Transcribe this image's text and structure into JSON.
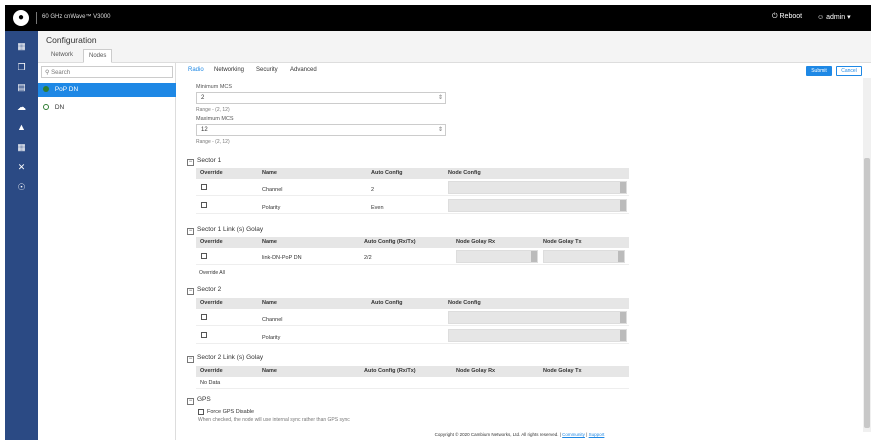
{
  "topbar": {
    "product": "60 GHz cnWave™ V3000",
    "reboot_label": "Reboot",
    "admin_label": "admin",
    "reboot_icon": "power-icon",
    "admin_icon": "user-icon",
    "dropdown_icon": "caret-down-icon"
  },
  "sidebar_icons": [
    "dashboard-icon",
    "copy-icon",
    "document-icon",
    "cloud-icon",
    "bell-icon",
    "calendar-icon",
    "tools-icon",
    "wireless-icon"
  ],
  "header": {
    "title": "Configuration",
    "tabs": [
      {
        "label": "Network",
        "active": false
      },
      {
        "label": "Nodes",
        "active": true
      }
    ]
  },
  "tree": {
    "search_placeholder": "Search",
    "nodes": [
      {
        "label": "PoP DN",
        "selected": true
      },
      {
        "label": "DN",
        "selected": false
      }
    ]
  },
  "tabs": [
    {
      "label": "Radio",
      "active": true
    },
    {
      "label": "Networking",
      "active": false
    },
    {
      "label": "Security",
      "active": false
    },
    {
      "label": "Advanced",
      "active": false
    }
  ],
  "buttons": {
    "submit": "Submit",
    "cancel": "Cancel"
  },
  "mcs": {
    "min_label": "Minimum MCS",
    "min_value": "2",
    "min_range": "Range - (2, 12)",
    "max_label": "Maximum MCS",
    "max_value": "12",
    "max_range": "Range - (2, 12)"
  },
  "sector1": {
    "title": "Sector 1",
    "columns": [
      "Override",
      "Name",
      "Auto Config",
      "Node Config"
    ],
    "rows": [
      {
        "name": "Channel",
        "auto": "2"
      },
      {
        "name": "Polarity",
        "auto": "Even"
      }
    ]
  },
  "sector1_golay": {
    "title": "Sector 1 Link (s) Golay",
    "columns": [
      "Override",
      "Name",
      "Auto Config (Rx/Tx)",
      "Node Golay Rx",
      "Node Golay Tx"
    ],
    "rows": [
      {
        "name": "link-DN-PoP DN",
        "auto": "2/2"
      }
    ],
    "override_all": "Override All"
  },
  "sector2": {
    "title": "Sector 2",
    "columns": [
      "Override",
      "Name",
      "Auto Config",
      "Node Config"
    ],
    "rows": [
      {
        "name": "Channel",
        "auto": ""
      },
      {
        "name": "Polarity",
        "auto": ""
      }
    ]
  },
  "sector2_golay": {
    "title": "Sector 2 Link (s) Golay",
    "columns": [
      "Override",
      "Name",
      "Auto Config (Rx/Tx)",
      "Node Golay Rx",
      "Node Golay Tx"
    ],
    "no_data": "No Data"
  },
  "gps": {
    "title": "GPS",
    "force_label": "Force GPS Disable",
    "force_hint": "When checked, the node will use internal sync rather than GPS sync"
  },
  "footer": {
    "copyright": "Copyright © 2020 Cambium Networks, Ltd. All rights reserved.",
    "sep": "|",
    "community": "Community",
    "support": "Support"
  }
}
